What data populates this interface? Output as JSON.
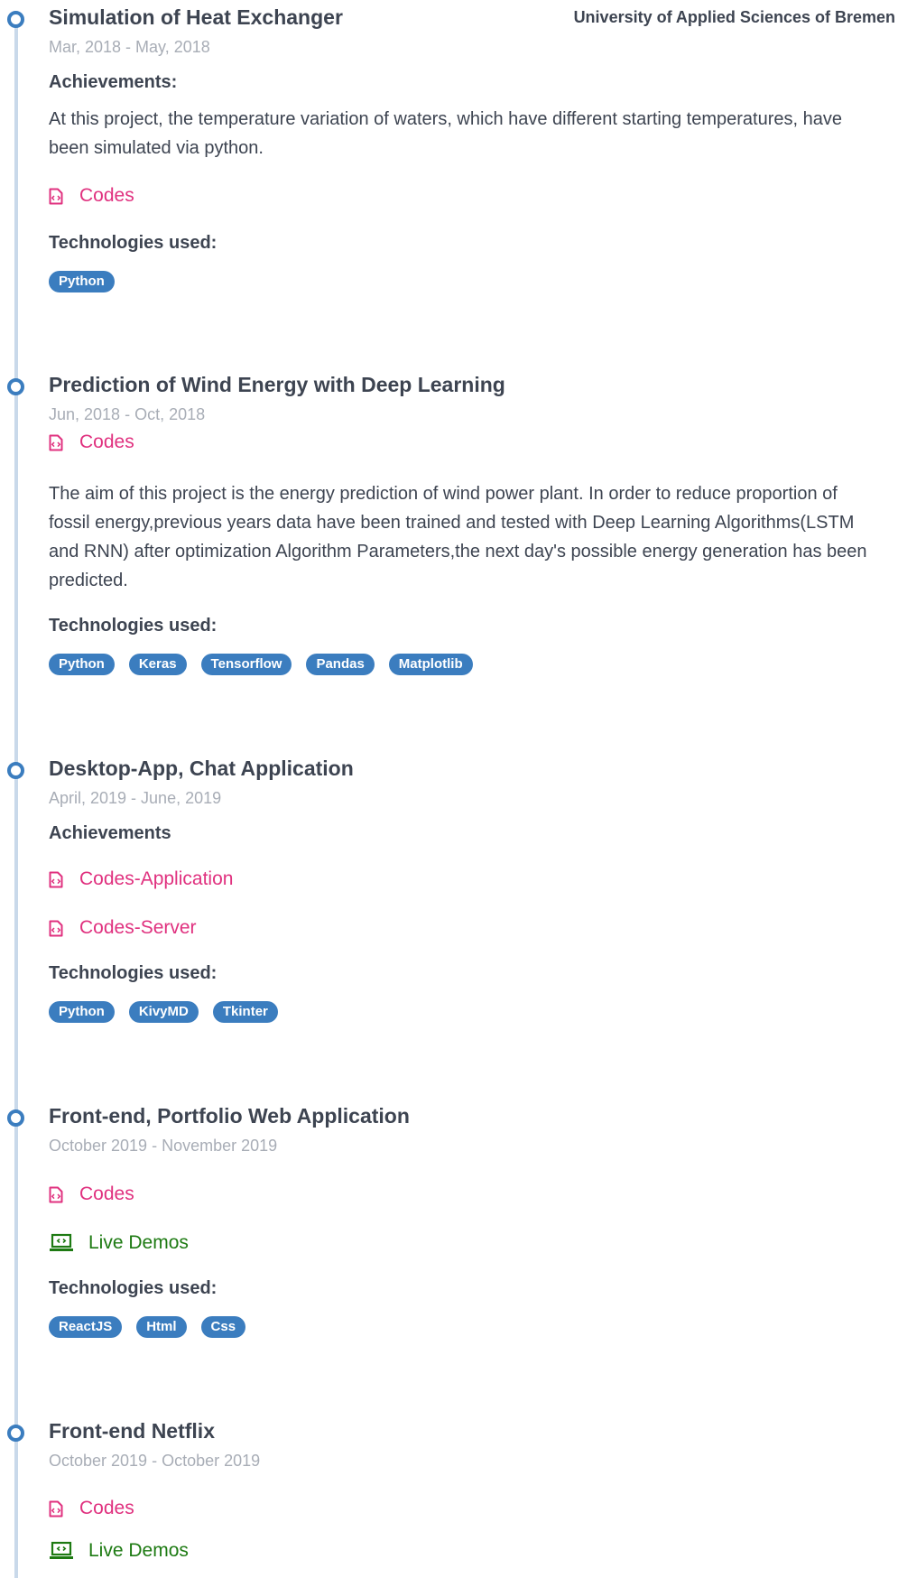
{
  "icons": {
    "code_file": "code-file-icon",
    "laptop": "laptop-code-icon"
  },
  "colors": {
    "accent": "#3b7dbf",
    "link": "#e0317f",
    "live_link": "#1d7a12",
    "timeline": "#c9d9ea"
  },
  "projects": [
    {
      "title": "Simulation of Heat Exchanger",
      "org": "University of Applied Sciences of Bremen",
      "date": "Mar, 2018 - May, 2018",
      "achievements_label": "Achievements:",
      "description": "At this project, the temperature variation of waters, which have different starting temperatures, have been simulated via python.",
      "links": [
        "Codes"
      ],
      "tech_label": "Technologies used:",
      "tags": [
        "Python"
      ]
    },
    {
      "title": "Prediction of Wind Energy with Deep Learning",
      "date": "Jun, 2018 - Oct, 2018",
      "links": [
        "Codes"
      ],
      "description": "The aim of this project is the energy prediction of wind power plant. In order to reduce proportion of fossil energy,previous years data have been trained and tested with Deep Learning Algorithms(LSTM and RNN) after optimization Algorithm Parameters,the next day's possible energy generation has been predicted.",
      "tech_label": "Technologies used:",
      "tags": [
        "Python",
        "Keras",
        "Tensorflow",
        "Pandas",
        "Matplotlib"
      ]
    },
    {
      "title": "Desktop-App, Chat Application",
      "date": "April, 2019 - June, 2019",
      "achievements_label": "Achievements",
      "links": [
        "Codes-Application",
        "Codes-Server"
      ],
      "tech_label": "Technologies used:",
      "tags": [
        "Python",
        "KivyMD",
        "Tkinter"
      ]
    },
    {
      "title": "Front-end, Portfolio Web Application",
      "date": "October 2019 - November 2019",
      "links": [
        "Codes"
      ],
      "live_link": "Live Demos",
      "tech_label": "Technologies used:",
      "tags": [
        "ReactJS",
        "Html",
        "Css"
      ]
    },
    {
      "title": "Front-end Netflix",
      "date": "October 2019 - October 2019",
      "links": [
        "Codes"
      ],
      "live_link": "Live Demos"
    }
  ]
}
